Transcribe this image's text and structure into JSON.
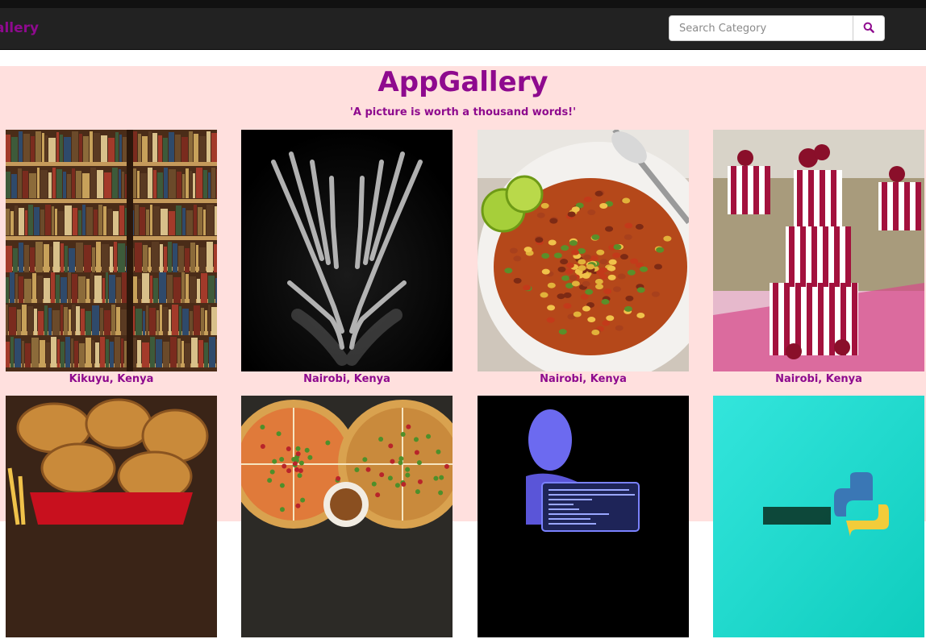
{
  "navbar": {
    "brand": "allery",
    "search": {
      "placeholder": "Search Category",
      "button_icon": "search-icon"
    }
  },
  "header": {
    "title": "AppGallery",
    "subtitle": "'A picture is worth a thousand words!'"
  },
  "gallery": {
    "items": [
      {
        "image": "bookshelf-photo",
        "location": "Kikuyu, Kenya"
      },
      {
        "image": "xray-hands-heart-photo",
        "location": "Nairobi, Kenya"
      },
      {
        "image": "bean-stew-plate-photo",
        "location": "Nairobi, Kenya"
      },
      {
        "image": "wedding-cake-photo",
        "location": "Nairobi, Kenya"
      },
      {
        "image": "fried-chicken-bucket-photo",
        "location": ""
      },
      {
        "image": "pizzas-photo",
        "location": ""
      },
      {
        "image": "hacker-laptop-photo",
        "location": ""
      },
      {
        "image": "django-python-logo-photo",
        "location": ""
      }
    ]
  },
  "colors": {
    "brand": "#8e0a8e",
    "navbar_bg": "#222222",
    "page_bg": "#ffe0de"
  }
}
